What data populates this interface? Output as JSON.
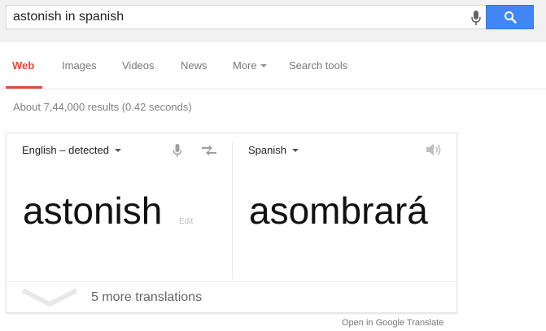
{
  "search": {
    "query": "astonish in spanish"
  },
  "nav": {
    "tabs": [
      {
        "label": "Web"
      },
      {
        "label": "Images"
      },
      {
        "label": "Videos"
      },
      {
        "label": "News"
      },
      {
        "label": "More"
      },
      {
        "label": "Search tools"
      }
    ]
  },
  "results": {
    "stats": "About 7,44,000 results (0.42 seconds)"
  },
  "translate": {
    "source_language": "English – detected",
    "target_language": "Spanish",
    "source_text": "astonish",
    "edit_label": "Edit",
    "target_text": "asombrará",
    "more_translations": "5 more translations",
    "open_link": "Open in Google Translate"
  },
  "colors": {
    "accent_red": "#dd4b39",
    "search_blue": "#4285f4",
    "top_bar_gray": "#f1f1f1"
  },
  "icons": {
    "mic": "microphone-icon",
    "search": "magnifier-icon",
    "swap": "swap-arrows-icon",
    "speaker": "speaker-icon",
    "expand": "chevron-down-icon"
  }
}
